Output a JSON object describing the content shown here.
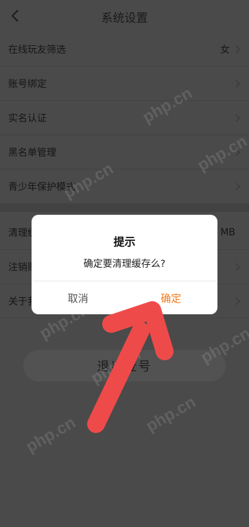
{
  "header": {
    "title": "系统设置",
    "back_icon": "chevron-left-icon"
  },
  "settings": {
    "items": [
      {
        "label": "在线玩友筛选",
        "value": "女"
      },
      {
        "label": "账号绑定",
        "value": ""
      },
      {
        "label": "实名认证",
        "value": ""
      },
      {
        "label": "黑名单管理",
        "value": ""
      },
      {
        "label": "青少年保护模式",
        "value": ""
      },
      {
        "label": "清理缓存",
        "value": "MB"
      },
      {
        "label": "注销账号",
        "value": ""
      },
      {
        "label": "关于我们",
        "value": ""
      }
    ]
  },
  "logout": {
    "label": "退出登号"
  },
  "dialog": {
    "title": "提示",
    "message": "确定要清理缓存么?",
    "cancel_label": "取消",
    "confirm_label": "确定"
  },
  "watermark": {
    "text": "php.cn"
  },
  "colors": {
    "accent": "#f07c1f",
    "overlay_bg": "#4a4a4a",
    "annotation_arrow": "#ef4a4a"
  }
}
